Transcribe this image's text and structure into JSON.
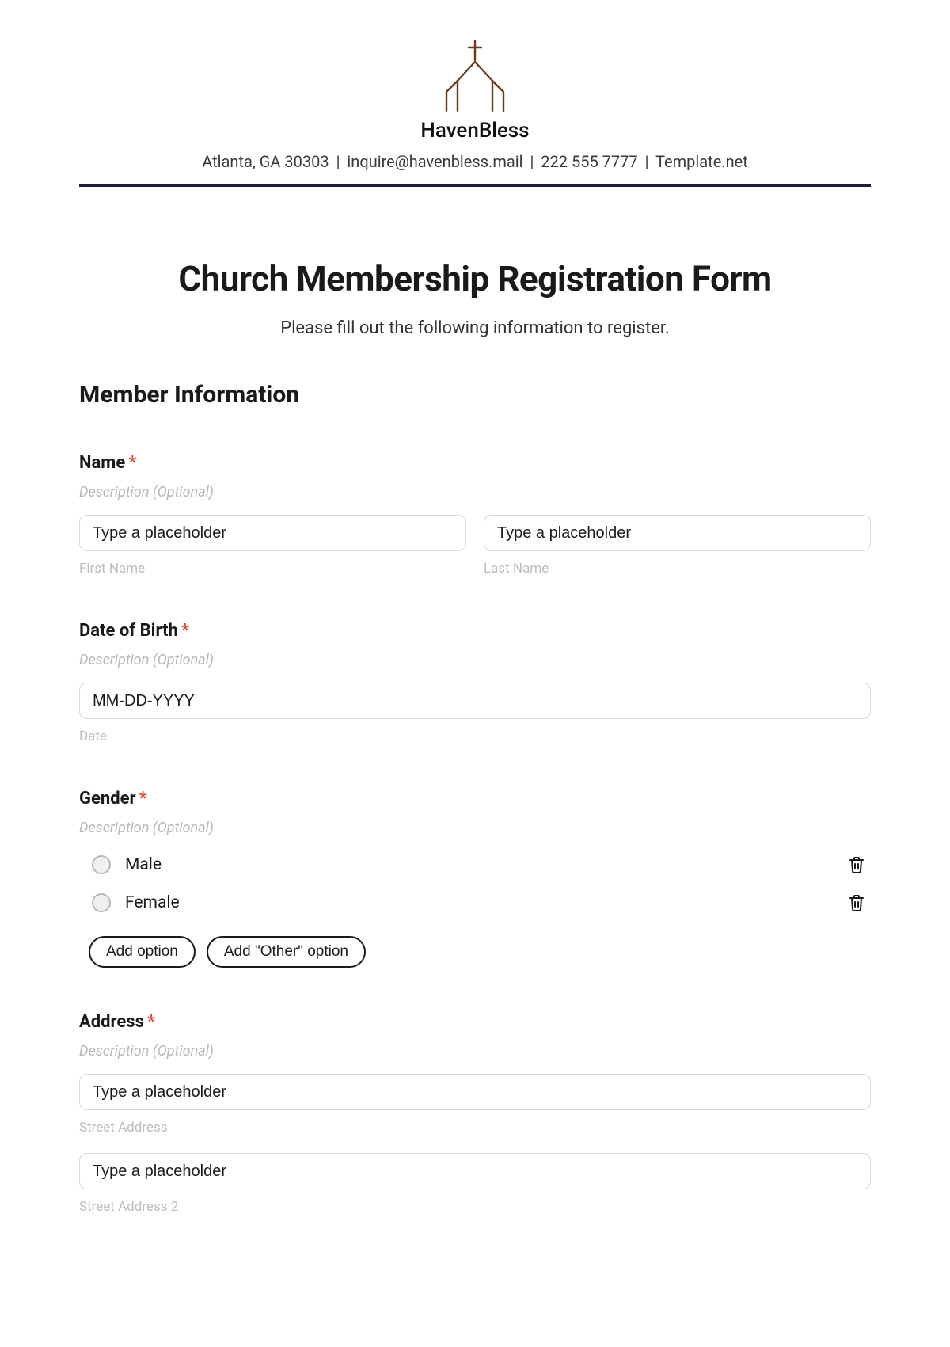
{
  "header": {
    "brand": "HavenBless",
    "address": "Atlanta, GA 30303",
    "email": "inquire@havenbless.mail",
    "phone": "222 555 7777",
    "site": "Template.net"
  },
  "form": {
    "title": "Church Membership Registration Form",
    "subtitle": "Please fill out the following information to register.",
    "section_title": "Member Information",
    "desc_placeholder": "Description (Optional)",
    "input_placeholder": "Type a placeholder",
    "name": {
      "label": "Name",
      "first_sub": "First Name",
      "last_sub": "Last Name"
    },
    "dob": {
      "label": "Date of Birth",
      "placeholder": "MM-DD-YYYY",
      "sub": "Date"
    },
    "gender": {
      "label": "Gender",
      "options": [
        "Male",
        "Female"
      ],
      "add_option": "Add option",
      "add_other": "Add \"Other\" option"
    },
    "address": {
      "label": "Address",
      "sub1": "Street Address",
      "sub2": "Street Address 2"
    }
  }
}
